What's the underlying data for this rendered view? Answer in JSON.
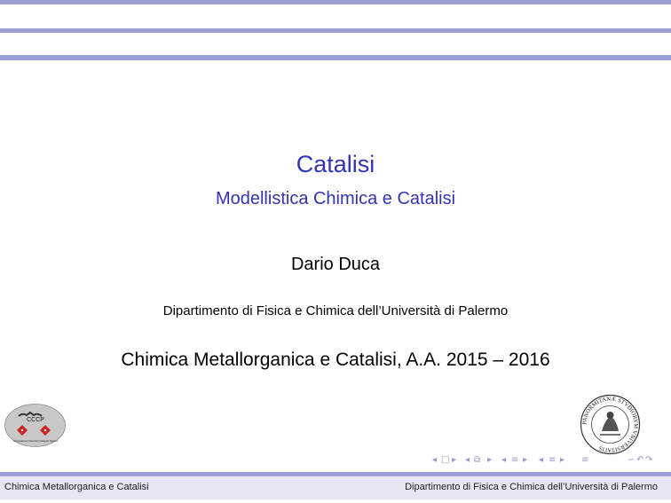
{
  "slide": {
    "title": "Catalisi",
    "subtitle": "Modellistica Chimica e Catalisi",
    "author": "Dario Duca",
    "institute": "Dipartimento di Fisica e Chimica dell’Università di Palermo",
    "date": "Chimica Metallorganica e Catalisi, A.A. 2015 – 2016"
  },
  "footer": {
    "left": "Chimica Metallorganica e Catalisi",
    "right": "Dipartimento di Fisica e Chimica dell’Università di Palermo"
  },
  "logos": {
    "left_text": "CCCP",
    "left_caption": "Computational Chemistry Catalysis Palermo",
    "right_text": "PANORMITANÆ STVDIORVM VNIVERSITATIS"
  },
  "colors": {
    "accent": "#3333b3",
    "bar": "#9e9ed6",
    "footer_bg": "#e7e7f4"
  }
}
